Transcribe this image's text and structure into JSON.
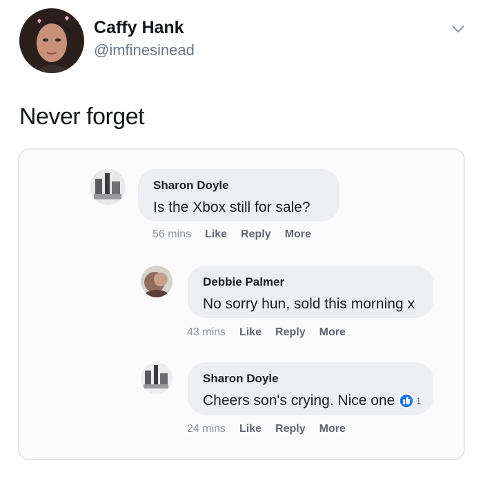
{
  "tweet": {
    "display_name": "Caffy Hank",
    "handle": "@imfinesinead",
    "text": "Never forget"
  },
  "comments": [
    {
      "author": "Sharon Doyle",
      "text": "Is the Xbox still for sale?",
      "time": "56 mins",
      "like_label": "Like",
      "reply_label": "Reply",
      "more_label": "More"
    },
    {
      "author": "Debbie Palmer",
      "text": "No sorry hun, sold this morning x",
      "time": "43 mins",
      "like_label": "Like",
      "reply_label": "Reply",
      "more_label": "More"
    },
    {
      "author": "Sharon Doyle",
      "text": "Cheers son's crying. Nice one",
      "time": "24 mins",
      "like_label": "Like",
      "reply_label": "Reply",
      "more_label": "More",
      "reaction_count": "1",
      "reaction_icon": "like-reaction-icon"
    }
  ],
  "colors": {
    "bubble": "#eceef1",
    "reaction_blue": "#1877f2",
    "handle_gray": "#657786"
  }
}
